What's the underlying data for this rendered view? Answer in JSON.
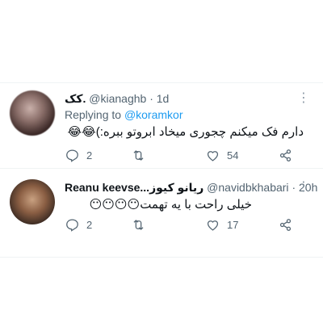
{
  "tweets": [
    {
      "name": "کک.",
      "handle": "@kianaghb",
      "time": "1d",
      "more_icon": "more-dots-icon",
      "replying_prefix": "Replying to",
      "replying_to": "@koramkor",
      "text": "دارم فک میکنم چجوری میخاد ابروتو ببره:)😂😂",
      "replies": "2",
      "retweets": "",
      "likes": "54"
    },
    {
      "name": "Reanu keevse...ریانو کیوز",
      "handle": "@navidbkhabari",
      "time": "20h",
      "more_icon": "more-dots-icon",
      "text": "خیلی راحت با یه تهمت😶😶😶😶",
      "replies": "2",
      "retweets": "",
      "likes": "17"
    }
  ],
  "separator": "·"
}
